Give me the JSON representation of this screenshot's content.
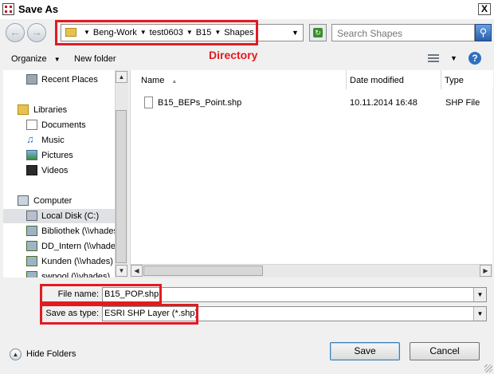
{
  "window": {
    "title": "Save As",
    "close_glyph": "X"
  },
  "nav": {
    "back_icon": "back-arrow-icon",
    "forward_icon": "forward-arrow-icon",
    "breadcrumbs": [
      "Beng-Work",
      "test0603",
      "B15",
      "Shapes"
    ],
    "search_placeholder": "Search Shapes"
  },
  "annotation": {
    "label": "Directory",
    "color": "#e11b22"
  },
  "toolbar": {
    "organize_label": "Organize",
    "new_folder_label": "New folder"
  },
  "sidebar": {
    "items": [
      {
        "label": "Recent Places",
        "icon": "recent-places-icon"
      },
      {
        "label": "Libraries",
        "icon": "libraries-icon"
      },
      {
        "label": "Documents",
        "icon": "documents-icon"
      },
      {
        "label": "Music",
        "icon": "music-icon"
      },
      {
        "label": "Pictures",
        "icon": "pictures-icon"
      },
      {
        "label": "Videos",
        "icon": "videos-icon"
      },
      {
        "label": "Computer",
        "icon": "computer-icon"
      },
      {
        "label": "Local Disk (C:)",
        "icon": "local-disk-icon",
        "selected": true
      },
      {
        "label": "Bibliothek (\\\\vhades",
        "icon": "network-drive-icon"
      },
      {
        "label": "DD_Intern (\\\\vhade",
        "icon": "network-drive-icon"
      },
      {
        "label": "Kunden (\\\\vhades)",
        "icon": "network-drive-icon"
      },
      {
        "label": "swpool (\\\\vhades)",
        "icon": "network-drive-icon"
      }
    ]
  },
  "file_list": {
    "columns": [
      "Name",
      "Date modified",
      "Type"
    ],
    "rows": [
      {
        "name": "B15_BEPs_Point.shp",
        "date_modified": "10.11.2014 16:48",
        "type": "SHP File"
      }
    ]
  },
  "form": {
    "file_name_label": "File name:",
    "file_name_value": "B15_POP.shp",
    "save_type_label": "Save as type:",
    "save_type_value": "ESRI SHP Layer (*.shp)"
  },
  "buttons": {
    "hide_folders": "Hide Folders",
    "save": "Save",
    "cancel": "Cancel"
  }
}
